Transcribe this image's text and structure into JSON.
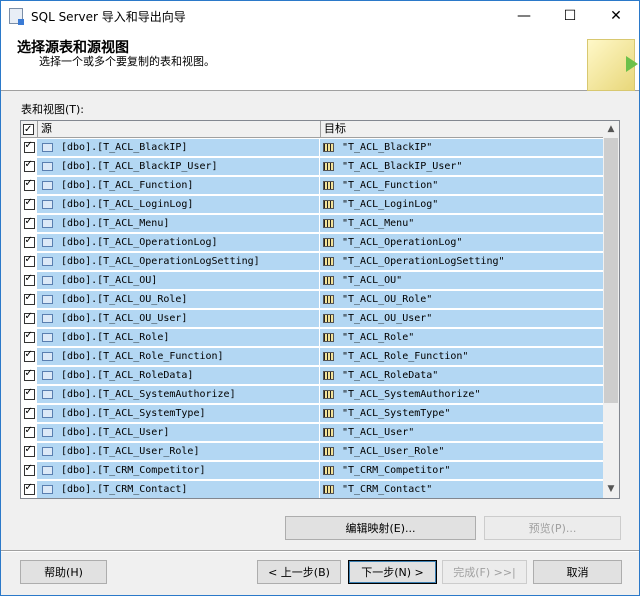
{
  "window": {
    "title": "SQL Server 导入和导出向导",
    "minimize": "—",
    "maximize": "☐",
    "close": "✕"
  },
  "header": {
    "title": "选择源表和源视图",
    "subtitle": "选择一个或多个要复制的表和视图。"
  },
  "list_label": "表和视图(T):",
  "columns": {
    "source": "源",
    "target": "目标"
  },
  "rows": [
    {
      "source": "[dbo].[T_ACL_BlackIP]",
      "target": "\"T_ACL_BlackIP\""
    },
    {
      "source": "[dbo].[T_ACL_BlackIP_User]",
      "target": "\"T_ACL_BlackIP_User\""
    },
    {
      "source": "[dbo].[T_ACL_Function]",
      "target": "\"T_ACL_Function\""
    },
    {
      "source": "[dbo].[T_ACL_LoginLog]",
      "target": "\"T_ACL_LoginLog\""
    },
    {
      "source": "[dbo].[T_ACL_Menu]",
      "target": "\"T_ACL_Menu\""
    },
    {
      "source": "[dbo].[T_ACL_OperationLog]",
      "target": "\"T_ACL_OperationLog\""
    },
    {
      "source": "[dbo].[T_ACL_OperationLogSetting]",
      "target": "\"T_ACL_OperationLogSetting\""
    },
    {
      "source": "[dbo].[T_ACL_OU]",
      "target": "\"T_ACL_OU\""
    },
    {
      "source": "[dbo].[T_ACL_OU_Role]",
      "target": "\"T_ACL_OU_Role\""
    },
    {
      "source": "[dbo].[T_ACL_OU_User]",
      "target": "\"T_ACL_OU_User\""
    },
    {
      "source": "[dbo].[T_ACL_Role]",
      "target": "\"T_ACL_Role\""
    },
    {
      "source": "[dbo].[T_ACL_Role_Function]",
      "target": "\"T_ACL_Role_Function\""
    },
    {
      "source": "[dbo].[T_ACL_RoleData]",
      "target": "\"T_ACL_RoleData\""
    },
    {
      "source": "[dbo].[T_ACL_SystemAuthorize]",
      "target": "\"T_ACL_SystemAuthorize\""
    },
    {
      "source": "[dbo].[T_ACL_SystemType]",
      "target": "\"T_ACL_SystemType\""
    },
    {
      "source": "[dbo].[T_ACL_User]",
      "target": "\"T_ACL_User\""
    },
    {
      "source": "[dbo].[T_ACL_User_Role]",
      "target": "\"T_ACL_User_Role\""
    },
    {
      "source": "[dbo].[T_CRM_Competitor]",
      "target": "\"T_CRM_Competitor\""
    },
    {
      "source": "[dbo].[T_CRM_Contact]",
      "target": "\"T_CRM_Contact\""
    }
  ],
  "buttons": {
    "edit_mapping": "编辑映射(E)...",
    "preview": "预览(P)...",
    "help": "帮助(H)",
    "back": "< 上一步(B)",
    "next": "下一步(N) >",
    "finish": "完成(F) >>|",
    "cancel": "取消"
  }
}
